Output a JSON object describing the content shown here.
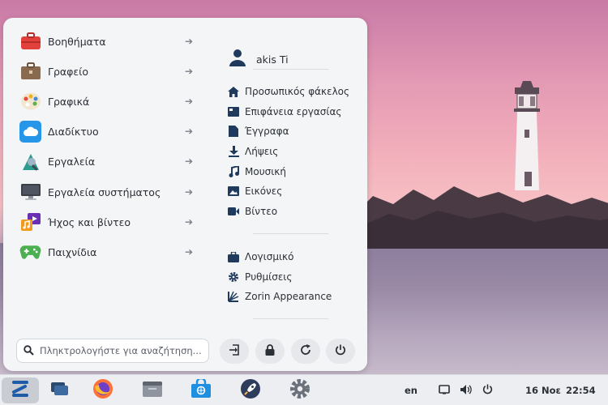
{
  "menu": {
    "categories": [
      {
        "label": "Βοηθήματα",
        "icon": "toolbox-icon"
      },
      {
        "label": "Γραφείο",
        "icon": "briefcase-icon"
      },
      {
        "label": "Γραφικά",
        "icon": "palette-icon"
      },
      {
        "label": "Διαδίκτυο",
        "icon": "cloud-icon"
      },
      {
        "label": "Εργαλεία",
        "icon": "tools-icon"
      },
      {
        "label": "Εργαλεία συστήματος",
        "icon": "monitor-icon"
      },
      {
        "label": "Ήχος και βίντεο",
        "icon": "media-icon"
      },
      {
        "label": "Παιχνίδια",
        "icon": "gamepad-icon"
      }
    ],
    "user": {
      "name": "akis Ti"
    },
    "places": [
      {
        "label": "Προσωπικός φάκελος",
        "icon": "home-icon"
      },
      {
        "label": "Επιφάνεια εργασίας",
        "icon": "desktop-icon"
      },
      {
        "label": "Έγγραφα",
        "icon": "document-icon"
      },
      {
        "label": "Λήψεις",
        "icon": "download-icon"
      },
      {
        "label": "Μουσική",
        "icon": "music-icon"
      },
      {
        "label": "Εικόνες",
        "icon": "image-icon"
      },
      {
        "label": "Βίντεο",
        "icon": "video-icon"
      }
    ],
    "system": [
      {
        "label": "Λογισμικό",
        "icon": "software-bag-icon"
      },
      {
        "label": "Ρυθμίσεις",
        "icon": "settings-gear-icon"
      },
      {
        "label": "Zorin Appearance",
        "icon": "zorin-appearance-icon"
      }
    ],
    "search": {
      "placeholder": "Πληκτρολογήστε για αναζήτηση..."
    },
    "power_buttons": [
      "logout-icon",
      "lock-icon",
      "restart-icon",
      "power-icon"
    ]
  },
  "taskbar": {
    "apps": [
      "zorin-menu-icon",
      "workspaces-icon",
      "firefox-icon",
      "files-icon",
      "software-store-icon",
      "rocket-icon",
      "settings-icon"
    ],
    "tray": {
      "language": "en",
      "date": "16 Νοε",
      "time": "22:54"
    }
  },
  "colors": {
    "accent": "#1f5ca8",
    "panel": "#f4f5f7",
    "taskbar": "#eceef1"
  }
}
